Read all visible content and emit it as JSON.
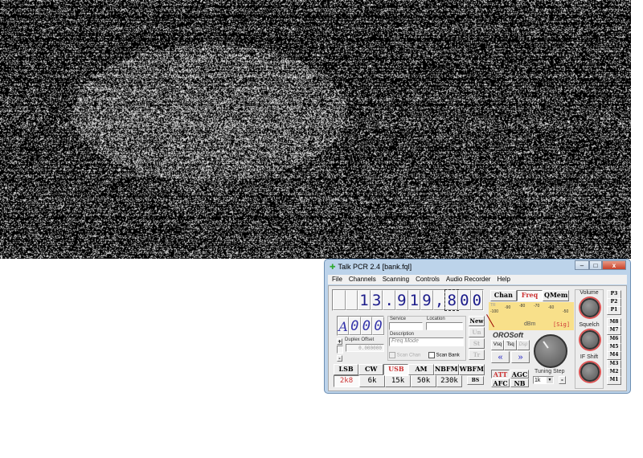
{
  "window": {
    "title": "Talk PCR 2.4 [bank.fql]",
    "min": "–",
    "max": "□",
    "close": "x"
  },
  "menu": [
    "File",
    "Channels",
    "Scanning",
    "Controls",
    "Audio Recorder",
    "Help"
  ],
  "frequency": {
    "digits": [
      "",
      "",
      "1",
      "3",
      ".",
      "9",
      "1",
      "9",
      ",",
      "8",
      "0",
      "0"
    ]
  },
  "channel": {
    "bank": "A",
    "number": [
      "0",
      "0",
      "0"
    ]
  },
  "service_label": "Service",
  "location_label": "Location",
  "description_label": "Description",
  "description_value": "Freq Mode",
  "duplex": {
    "label": "Duplex Offset",
    "value": "0.000000",
    "plus": "+",
    "minus": "-"
  },
  "scan_chan": "Scan Chan",
  "scan_bank": "Scan Bank",
  "side_buttons": [
    "New",
    "Un",
    "St",
    "Tr"
  ],
  "modes": [
    "LSB",
    "CW",
    "USB",
    "AM",
    "NBFM",
    "WBFM"
  ],
  "active_mode": "USB",
  "filters": [
    "2k8",
    "6k",
    "15k",
    "50k",
    "230k"
  ],
  "active_filter": "2k8",
  "bs": "BS",
  "tabs": [
    "Chan",
    "Freq",
    "QMem"
  ],
  "active_tab": "Freq",
  "meter": {
    "tr": "TR",
    "scale": [
      "-100",
      "-90",
      "-80",
      "-70",
      "-60",
      "-50"
    ],
    "unit": "dBm",
    "sig": "[Sig]",
    "color": "#f8e08a"
  },
  "brand": "OROSoft",
  "squelch_buttons": [
    "Vsq",
    "Tsq",
    "Dsp"
  ],
  "arrows": {
    "left": "«",
    "right": "»"
  },
  "toggles": [
    "ATT",
    "AGC",
    "AFC",
    "NB"
  ],
  "tuning": {
    "label": "Tuning Step",
    "value": "1k",
    "minus": "-"
  },
  "knobs": [
    "Volume",
    "Squelch",
    "IF Shift"
  ],
  "presets": [
    "P3",
    "P2",
    "P1"
  ],
  "memories": [
    "M8",
    "M7",
    "M6",
    "M5",
    "M4",
    "M3",
    "M2",
    "M1"
  ]
}
